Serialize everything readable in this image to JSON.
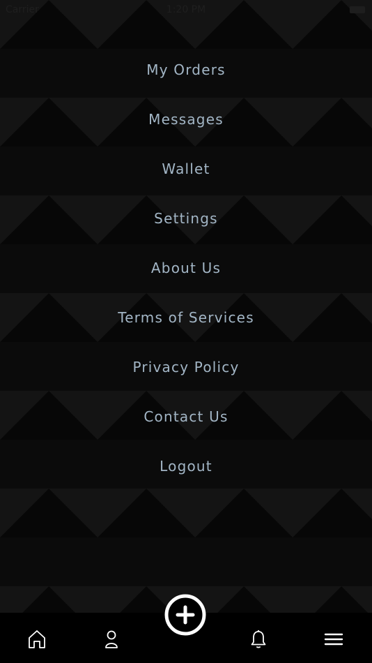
{
  "status_bar": {
    "carrier": "Carrier",
    "time": "1:20 PM"
  },
  "menu": {
    "items": [
      {
        "label": "My Orders"
      },
      {
        "label": "Messages"
      },
      {
        "label": "Wallet"
      },
      {
        "label": "Settings"
      },
      {
        "label": "About Us"
      },
      {
        "label": "Terms of Services"
      },
      {
        "label": "Privacy Policy"
      },
      {
        "label": "Contact Us"
      },
      {
        "label": "Logout"
      }
    ]
  },
  "tab_bar": {
    "icons": [
      "home-icon",
      "profile-icon",
      "add-icon",
      "bell-icon",
      "menu-icon"
    ]
  },
  "colors": {
    "menu_text": "#a3b6c6",
    "background": "#0b0b0b",
    "tab_bar": "#000000",
    "icon": "#ffffff"
  }
}
